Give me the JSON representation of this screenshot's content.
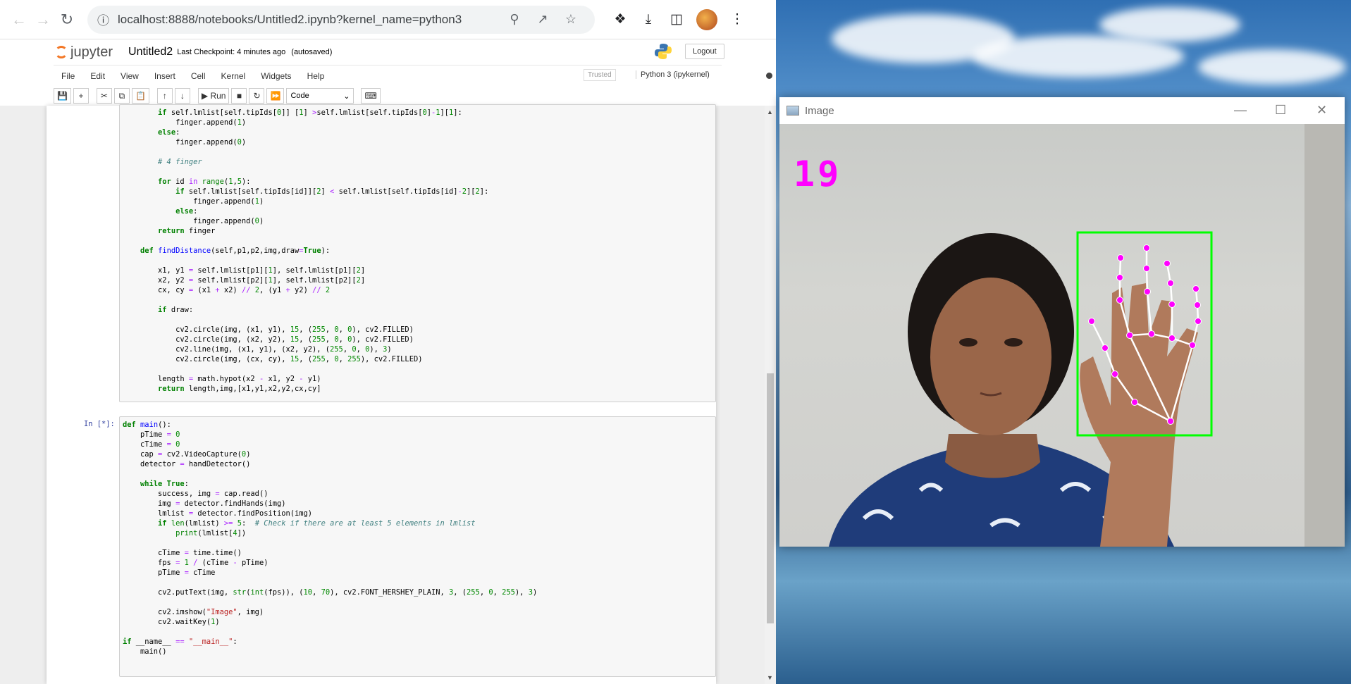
{
  "browser": {
    "url": "localhost:8888/notebooks/Untitled2.ipynb?kernel_name=python3"
  },
  "jupyter": {
    "logo": "jupyter",
    "notebook_name": "Untitled2",
    "checkpoint": "Last Checkpoint: 4 minutes ago",
    "autosave": "(autosaved)",
    "logout": "Logout",
    "menu": [
      "File",
      "Edit",
      "View",
      "Insert",
      "Cell",
      "Kernel",
      "Widgets",
      "Help"
    ],
    "trusted": "Trusted",
    "kernel": "Python 3 (ipykernel)",
    "run_label": "Run",
    "cell_type": "Code",
    "prompt2": "In [*]:"
  },
  "image_window": {
    "title": "Image",
    "fps_text": "19"
  },
  "colors": {
    "fps_magenta": "#ff00ff",
    "bbox_green": "#00ff00",
    "landmark_magenta": "#ff00ff"
  }
}
